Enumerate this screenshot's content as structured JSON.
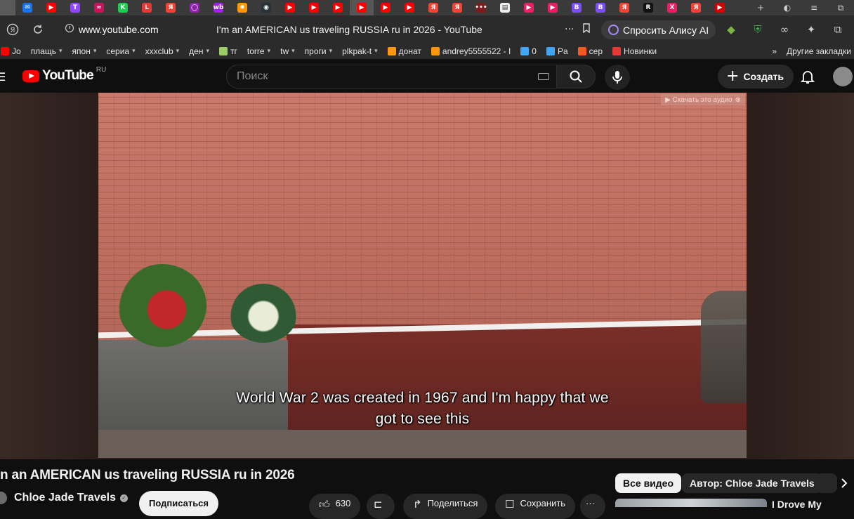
{
  "browser": {
    "tabs": [
      {
        "icon": "generic-tab-icon",
        "glyph": "",
        "color": "#5a5a5a"
      },
      {
        "icon": "mail-tab-icon",
        "glyph": "✉",
        "color": "#1a73e8"
      },
      {
        "icon": "youtube-tab-icon",
        "glyph": "▶",
        "color": "#ff0000"
      },
      {
        "icon": "twitch-tab-icon",
        "glyph": "T",
        "color": "#9146ff"
      },
      {
        "icon": "link-tab-icon",
        "glyph": "≈",
        "color": "#c2185b"
      },
      {
        "icon": "kinopoisk-tab-icon",
        "glyph": "K",
        "color": "#1fcc4e"
      },
      {
        "icon": "live-tab-icon",
        "glyph": "L",
        "color": "#e53935"
      },
      {
        "icon": "yandex-tab-icon",
        "glyph": "Я",
        "color": "#f44336"
      },
      {
        "icon": "ring-tab-icon",
        "glyph": "◯",
        "color": "#8e24aa"
      },
      {
        "icon": "wb-tab-icon",
        "glyph": "wb",
        "color": "#a020f0"
      },
      {
        "icon": "fire-tab-icon",
        "glyph": "✹",
        "color": "#ff9800"
      },
      {
        "icon": "dark-tab-icon",
        "glyph": "◉",
        "color": "#263238"
      },
      {
        "icon": "youtube-tab-icon",
        "glyph": "▶",
        "color": "#ff0000"
      },
      {
        "icon": "youtube-tab-icon",
        "glyph": "▶",
        "color": "#ff0000"
      },
      {
        "icon": "youtube-tab-icon",
        "glyph": "▶",
        "color": "#ff0000"
      },
      {
        "icon": "youtube-tab-icon",
        "glyph": "▶",
        "color": "#ff0000",
        "active": true
      },
      {
        "icon": "youtube-tab-icon",
        "glyph": "▶",
        "color": "#ff0000"
      },
      {
        "icon": "youtube-tab-icon",
        "glyph": "▶",
        "color": "#ff0000"
      },
      {
        "icon": "yandex-tab-icon",
        "glyph": "Я",
        "color": "#f44336"
      },
      {
        "icon": "yandex-tab-icon",
        "glyph": "Я",
        "color": "#f44336"
      },
      {
        "icon": "dots-tab-icon",
        "glyph": "•••",
        "color": "#7b1b1b"
      },
      {
        "icon": "doc-tab-icon",
        "glyph": "▤",
        "color": "#eeeeee"
      },
      {
        "icon": "play-tab-icon",
        "glyph": "▶",
        "color": "#e91e63"
      },
      {
        "icon": "play-tab-icon",
        "glyph": "▶",
        "color": "#e91e63"
      },
      {
        "icon": "b-tab-icon",
        "glyph": "B",
        "color": "#7c4dff"
      },
      {
        "icon": "b-tab-icon",
        "glyph": "B",
        "color": "#7c4dff"
      },
      {
        "icon": "yandex-tab-icon",
        "glyph": "Я",
        "color": "#f44336"
      },
      {
        "icon": "r-tab-icon",
        "glyph": "R",
        "color": "#111111"
      },
      {
        "icon": "x-tab-icon",
        "glyph": "X",
        "color": "#e91e63"
      },
      {
        "icon": "yandex-tab-icon",
        "glyph": "Я",
        "color": "#f44336"
      },
      {
        "icon": "youtube-tab-icon",
        "glyph": "▶",
        "color": "#d50000"
      }
    ],
    "new_tab_glyph": "+",
    "window_controls": [
      "◐",
      "≡",
      "⧉"
    ],
    "url_host": "www.youtube.com",
    "page_title": "I'm an AMERICAN us traveling RUSSIA ru in 2026 - YouTube",
    "more_glyph": "···",
    "bookmark_glyph": "⊓",
    "alice_label": "Спросить Алису AI",
    "extension_glyphs": [
      "◆",
      "⛨",
      "∞",
      "✦",
      "⧉"
    ],
    "bookmarks": [
      {
        "label": "Jo",
        "color": "#ff0000",
        "folder": false
      },
      {
        "label": "плащь",
        "color": "",
        "folder": true
      },
      {
        "label": "япон",
        "color": "",
        "folder": true
      },
      {
        "label": "сериа",
        "color": "",
        "folder": true
      },
      {
        "label": "xxxclub",
        "color": "",
        "folder": true
      },
      {
        "label": "ден",
        "color": "",
        "folder": true
      },
      {
        "label": "тг",
        "color": "#9ccc65",
        "folder": false
      },
      {
        "label": "torre",
        "color": "",
        "folder": true
      },
      {
        "label": "tw",
        "color": "",
        "folder": true
      },
      {
        "label": "проги",
        "color": "",
        "folder": true
      },
      {
        "label": "plkpak-t",
        "color": "",
        "folder": true
      },
      {
        "label": "донат",
        "color": "#ff9800",
        "folder": false
      },
      {
        "label": "andrey5555522 - I",
        "color": "#ff9800",
        "folder": false
      },
      {
        "label": "0",
        "color": "#42a5f5",
        "folder": false
      },
      {
        "label": "Pa",
        "color": "#42a5f5",
        "folder": false
      },
      {
        "label": "сер",
        "color": "#ff5722",
        "folder": false
      },
      {
        "label": "Новинки",
        "color": "#e53935",
        "folder": false
      }
    ],
    "bookmarks_overflow": "»",
    "other_bookmarks": "Другие закладки"
  },
  "youtube": {
    "logo_text": "YouTube",
    "region": "RU",
    "search_placeholder": "Поиск",
    "create_label": "Создать",
    "video": {
      "audio_tip": "▶ Скачать это аудио",
      "caption_lines": [
        "World War 2 was created in 1967 and I'm happy that we",
        "got to see this"
      ]
    },
    "title": "n an AMERICAN us traveling RUSSIA ru in 2026",
    "channel": "Chloe Jade Travels",
    "subscribe_label": "Подписаться",
    "likes": "630",
    "share_label": "Поделиться",
    "save_label": "Сохранить",
    "more_glyph": "···",
    "chips": [
      "Все видео",
      "Автор: Chloe Jade Travels"
    ],
    "recommended_title": "I Drove My"
  }
}
